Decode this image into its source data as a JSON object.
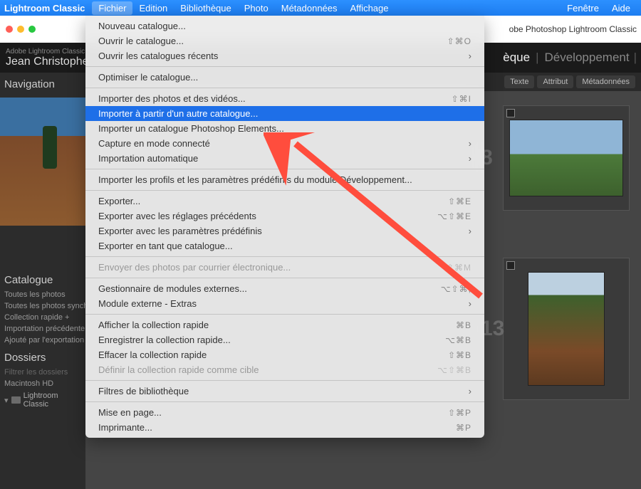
{
  "menubar": {
    "app": "Lightroom Classic",
    "items": [
      "Fichier",
      "Edition",
      "Bibliothèque",
      "Photo",
      "Métadonnées",
      "Affichage"
    ],
    "right": [
      "Fenêtre",
      "Aide"
    ],
    "active_index": 0
  },
  "window_title": "obe Photoshop Lightroom Classic",
  "identity": {
    "small": "Adobe Lightroom Classic",
    "name": "Jean Christophe"
  },
  "modules": {
    "visible": [
      "èque",
      "Développement"
    ],
    "selected": 0
  },
  "filterbar": [
    "Texte",
    "Attribut",
    "Métadonnées"
  ],
  "left_panel": {
    "navigation": "Navigation",
    "catalogue": "Catalogue",
    "items": [
      "Toutes les photos",
      "Toutes les photos synch",
      "Collection rapide +",
      "Importation précédente",
      "Ajouté par l'exportation"
    ],
    "dossiers": "Dossiers",
    "filter_placeholder": "Filtrer les dossiers",
    "volume": "Macintosh HD",
    "folder": "Lightroom Classic"
  },
  "grid_numbers": [
    "8",
    "13"
  ],
  "dropdown": {
    "groups": [
      [
        {
          "label": "Nouveau catalogue...",
          "shortcut": "",
          "submenu": false,
          "disabled": false
        },
        {
          "label": "Ouvrir le catalogue...",
          "shortcut": "⇧⌘O",
          "submenu": false,
          "disabled": false
        },
        {
          "label": "Ouvrir les catalogues récents",
          "shortcut": "",
          "submenu": true,
          "disabled": false
        }
      ],
      [
        {
          "label": "Optimiser le catalogue...",
          "shortcut": "",
          "submenu": false,
          "disabled": false
        }
      ],
      [
        {
          "label": "Importer des photos et des vidéos...",
          "shortcut": "⇧⌘I",
          "submenu": false,
          "disabled": false
        },
        {
          "label": "Importer à partir d'un autre catalogue...",
          "shortcut": "",
          "submenu": false,
          "disabled": false,
          "highlight": true
        },
        {
          "label": "Importer un catalogue Photoshop Elements...",
          "shortcut": "",
          "submenu": false,
          "disabled": false
        },
        {
          "label": "Capture en mode connecté",
          "shortcut": "",
          "submenu": true,
          "disabled": false
        },
        {
          "label": "Importation automatique",
          "shortcut": "",
          "submenu": true,
          "disabled": false
        }
      ],
      [
        {
          "label": "Importer les profils et les paramètres prédéfinis du module Développement...",
          "shortcut": "",
          "submenu": false,
          "disabled": false
        }
      ],
      [
        {
          "label": "Exporter...",
          "shortcut": "⇧⌘E",
          "submenu": false,
          "disabled": false
        },
        {
          "label": "Exporter avec les réglages précédents",
          "shortcut": "⌥⇧⌘E",
          "submenu": false,
          "disabled": false
        },
        {
          "label": "Exporter avec les paramètres prédéfinis",
          "shortcut": "",
          "submenu": true,
          "disabled": false
        },
        {
          "label": "Exporter en tant que catalogue...",
          "shortcut": "",
          "submenu": false,
          "disabled": false
        }
      ],
      [
        {
          "label": "Envoyer des photos par courrier électronique...",
          "shortcut": "⇧⌘M",
          "submenu": false,
          "disabled": true
        }
      ],
      [
        {
          "label": "Gestionnaire de modules externes...",
          "shortcut": "⌥⇧⌘,",
          "submenu": false,
          "disabled": false
        },
        {
          "label": "Module externe - Extras",
          "shortcut": "",
          "submenu": true,
          "disabled": false
        }
      ],
      [
        {
          "label": "Afficher la collection rapide",
          "shortcut": "⌘B",
          "submenu": false,
          "disabled": false
        },
        {
          "label": "Enregistrer la collection rapide...",
          "shortcut": "⌥⌘B",
          "submenu": false,
          "disabled": false
        },
        {
          "label": "Effacer la collection rapide",
          "shortcut": "⇧⌘B",
          "submenu": false,
          "disabled": false
        },
        {
          "label": "Définir la collection rapide comme cible",
          "shortcut": "⌥⇧⌘B",
          "submenu": false,
          "disabled": true
        }
      ],
      [
        {
          "label": "Filtres de bibliothèque",
          "shortcut": "",
          "submenu": true,
          "disabled": false
        }
      ],
      [
        {
          "label": "Mise en page...",
          "shortcut": "⇧⌘P",
          "submenu": false,
          "disabled": false
        },
        {
          "label": "Imprimante...",
          "shortcut": "⌘P",
          "submenu": false,
          "disabled": false
        }
      ]
    ]
  }
}
